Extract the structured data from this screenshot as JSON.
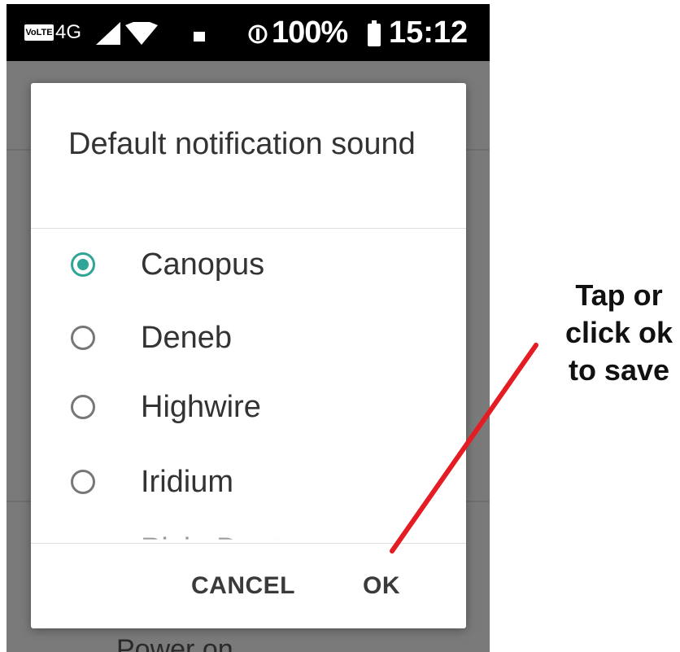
{
  "status_bar": {
    "volte": "VoLTE",
    "network": "4G",
    "battery": "100%",
    "time": "15:12",
    "icons": [
      "volte-icon",
      "signal-icon",
      "wifi-icon",
      "image-notification-icon",
      "sync-icon",
      "battery-icon"
    ]
  },
  "background": {
    "partial_text": "Power on"
  },
  "dialog": {
    "title": "Default notification sound",
    "options": [
      {
        "label": "Canopus",
        "selected": true
      },
      {
        "label": "Deneb",
        "selected": false
      },
      {
        "label": "Highwire",
        "selected": false
      },
      {
        "label": "Iridium",
        "selected": false
      }
    ],
    "cut_off_option": "Pixie Dust",
    "cancel_label": "CANCEL",
    "ok_label": "OK"
  },
  "annotation": {
    "text": "Tap or click ok to save",
    "color": "#e31d23"
  },
  "colors": {
    "accent": "#2fa597",
    "status_bar": "#000000",
    "scrim": "#7a7a7a"
  }
}
